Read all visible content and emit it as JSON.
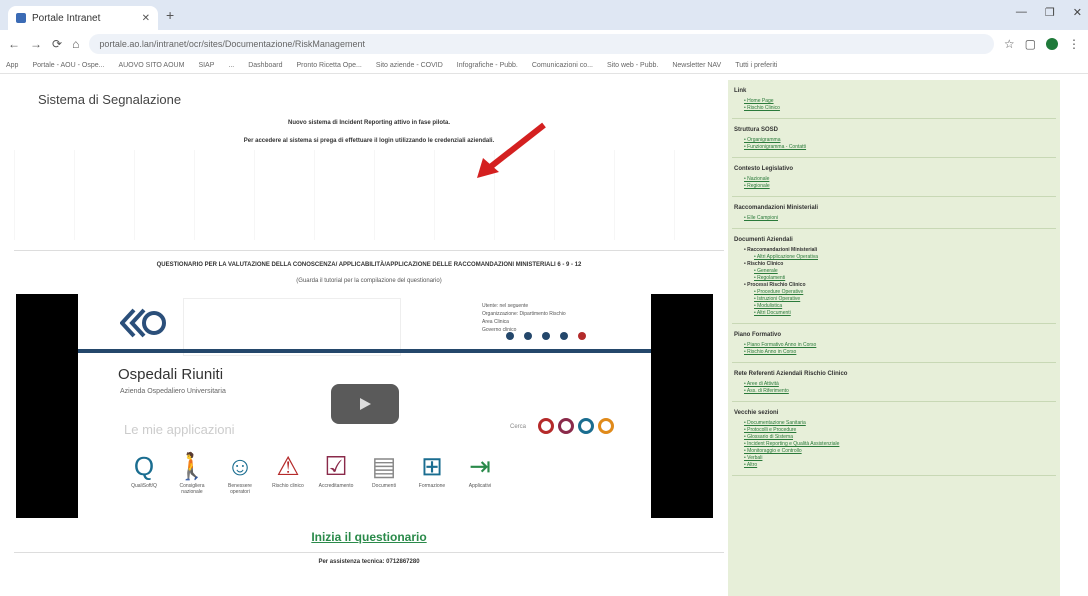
{
  "browser": {
    "tab_title": "Portale Intranet",
    "url": "portale.ao.lan/intranet/ocr/sites/Documentazione/RiskManagement",
    "bookmarks": [
      "App",
      "Portale - AOU - Ospe...",
      "AUOVO SITO AOUM",
      "SIAP",
      "...",
      "Dashboard",
      "Pronto Ricetta Ope...",
      "Sito aziende - COVID",
      "Infografiche - Pubb.",
      "Comunicazioni co...",
      "Sito web - Pubb.",
      "Newsletter NAV",
      "Tutti i preferiti"
    ]
  },
  "main": {
    "title": "Sistema di Segnalazione",
    "notice_1": "Nuovo sistema di Incident Reporting attivo in fase pilota.",
    "notice_2": "Per accedere al sistema si prega di effettuare il login utilizzando le credenziali aziendali.",
    "questionnaire_heading": "QUESTIONARIO PER LA VALUTAZIONE DELLA CONOSCENZA/ APPLICABILITÀ/APPLICAZIONE DELLE RACCOMANDAZIONI MINISTERIALI 6 - 9 - 12",
    "questionnaire_sub": "(Guarda il tutorial per la compilazione del questionario)",
    "start_link": "Inizia il questionario",
    "help_text": "Per assistenza tecnica: 0712867280"
  },
  "video": {
    "brand": "Ospedali Riuniti",
    "subtitle": "Azienda Ospedaliero Universitaria",
    "my_apps": "Le mie applicazioni",
    "search_label": "Cerca",
    "user_links": [
      "Utente: nel seguente",
      "Organizzazione: Dipartimento Rischio",
      "Area Clinica",
      "Governo clinico"
    ],
    "apps": [
      {
        "glyph": "Q",
        "label": "QualiSoft/Q"
      },
      {
        "glyph": "🚶",
        "label": "Consigliera nazionale"
      },
      {
        "glyph": "☺",
        "label": "Benessere operatori"
      },
      {
        "glyph": "⚠",
        "label": "Rischio clinico"
      },
      {
        "glyph": "☑",
        "label": "Accreditamento"
      },
      {
        "glyph": "▤",
        "label": "Documenti"
      },
      {
        "glyph": "⊞",
        "label": "Formazione"
      },
      {
        "glyph": "⇥",
        "label": "Applicativi"
      }
    ]
  },
  "sidebar": {
    "sections": [
      {
        "title": "Link",
        "items": [
          {
            "label": "Home Page",
            "t": "l"
          },
          {
            "label": "Rischio Clinico",
            "t": "l"
          }
        ]
      },
      {
        "title": "Struttura SOSD",
        "items": [
          {
            "label": "Organigramma",
            "t": "l"
          },
          {
            "label": "Funzionigramma - Contatti",
            "t": "l"
          }
        ]
      },
      {
        "title": "Contesto Legislativo",
        "items": [
          {
            "label": "Nazionale",
            "t": "l"
          },
          {
            "label": "Regionale",
            "t": "l"
          }
        ]
      },
      {
        "title": "Raccomandazioni Ministeriali",
        "items": [
          {
            "label": "Elle Campioni",
            "t": "l"
          }
        ]
      },
      {
        "title": "Documenti Aziendali",
        "items": [
          {
            "label": "Raccomandazioni Ministeriali",
            "t": "h"
          },
          {
            "label": "Altri Applicazione Operativa",
            "t": "s"
          },
          {
            "label": "Rischio Clinico",
            "t": "h"
          },
          {
            "label": "Generale",
            "t": "s"
          },
          {
            "label": "Regolamenti",
            "t": "s"
          },
          {
            "label": "Processi Rischio Clinico",
            "t": "h"
          },
          {
            "label": "Procedure Operative",
            "t": "s"
          },
          {
            "label": "Istruzioni Operative",
            "t": "s"
          },
          {
            "label": "Modulistica",
            "t": "s"
          },
          {
            "label": "Altri Documenti",
            "t": "s"
          }
        ]
      },
      {
        "title": "Piano Formativo",
        "items": [
          {
            "label": "Piano Formativo Anno in Corso",
            "t": "l"
          },
          {
            "label": "Rischio Anno in Corso",
            "t": "l"
          }
        ]
      },
      {
        "title": "Rete Referenti Aziendali Rischio Clinico",
        "items": [
          {
            "label": "Aree di Attività",
            "t": "l"
          },
          {
            "label": "Ass. di Riferimento",
            "t": "l"
          }
        ]
      },
      {
        "title": "Vecchie sezioni",
        "items": [
          {
            "label": "Documentazione Sanitaria",
            "t": "l"
          },
          {
            "label": "Protocolli e Procedure",
            "t": "l"
          },
          {
            "label": "Glossario di Sistema",
            "t": "l"
          },
          {
            "label": "Incident Reporting e Qualità Assistenziale",
            "t": "l"
          },
          {
            "label": "Monitoraggio e Controllo",
            "t": "l"
          },
          {
            "label": "Verbali",
            "t": "l"
          },
          {
            "label": "Altro",
            "t": "l"
          }
        ]
      }
    ]
  }
}
